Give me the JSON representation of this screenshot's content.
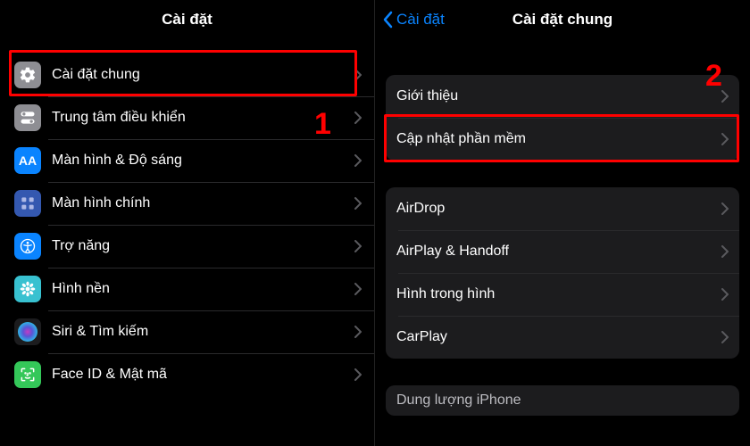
{
  "left": {
    "title": "Cài đặt",
    "rows": [
      {
        "label": "Cài đặt chung"
      },
      {
        "label": "Trung tâm điều khiển"
      },
      {
        "label": "Màn hình & Độ sáng"
      },
      {
        "label": "Màn hình chính"
      },
      {
        "label": "Trợ năng"
      },
      {
        "label": "Hình nền"
      },
      {
        "label": "Siri & Tìm kiếm"
      },
      {
        "label": "Face ID & Mật mã"
      }
    ],
    "callout_num": "1"
  },
  "right": {
    "back_label": "Cài đặt",
    "title": "Cài đặt chung",
    "group1": [
      {
        "label": "Giới thiệu"
      },
      {
        "label": "Cập nhật phần mềm"
      }
    ],
    "group2": [
      {
        "label": "AirDrop"
      },
      {
        "label": "AirPlay & Handoff"
      },
      {
        "label": "Hình trong hình"
      },
      {
        "label": "CarPlay"
      }
    ],
    "cutoff_label": "Dung lượng iPhone",
    "callout_num": "2"
  },
  "icons": {
    "display_text": "AA"
  }
}
